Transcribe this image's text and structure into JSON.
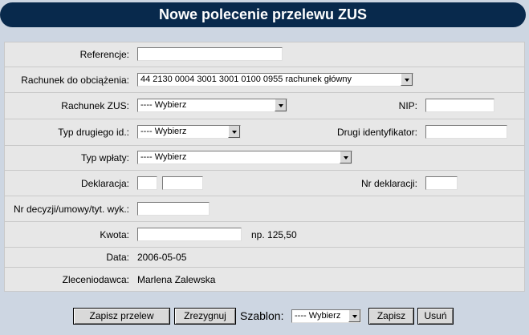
{
  "title": "Nowe polecenie przelewu ZUS",
  "form": {
    "referencje": {
      "label": "Referencje:",
      "value": ""
    },
    "rachunek_obciazenia": {
      "label": "Rachunek do obciążenia:",
      "selected": "44 2130 0004 3001 3001 0100 0955 rachunek główny"
    },
    "rachunek_zus": {
      "label": "Rachunek ZUS:",
      "selected": "---- Wybierz"
    },
    "nip": {
      "label": "NIP:",
      "value": ""
    },
    "typ_drugiego_id": {
      "label": "Typ drugiego id.:",
      "selected": "---- Wybierz"
    },
    "drugi_identyfikator": {
      "label": "Drugi identyfikator:",
      "value": ""
    },
    "typ_wplaty": {
      "label": "Typ wpłaty:",
      "selected": "---- Wybierz"
    },
    "deklaracja": {
      "label": "Deklaracja:",
      "value1": "",
      "value2": ""
    },
    "nr_deklaracji": {
      "label": "Nr deklaracji:",
      "value": ""
    },
    "nr_decyzji": {
      "label": "Nr decyzji/umowy/tyt. wyk.:",
      "value": ""
    },
    "kwota": {
      "label": "Kwota:",
      "value": "",
      "hint": "np. 125,50"
    },
    "data": {
      "label": "Data:",
      "value": "2006-05-05"
    },
    "zleceniodawca": {
      "label": "Zleceniodawca:",
      "value": "Marlena Zalewska"
    }
  },
  "footer": {
    "save_label": "Zapisz przelew",
    "cancel_label": "Zrezygnuj",
    "template_label": "Szablon:",
    "template_selected": "---- Wybierz",
    "template_save_label": "Zapisz",
    "template_delete_label": "Usuń"
  }
}
